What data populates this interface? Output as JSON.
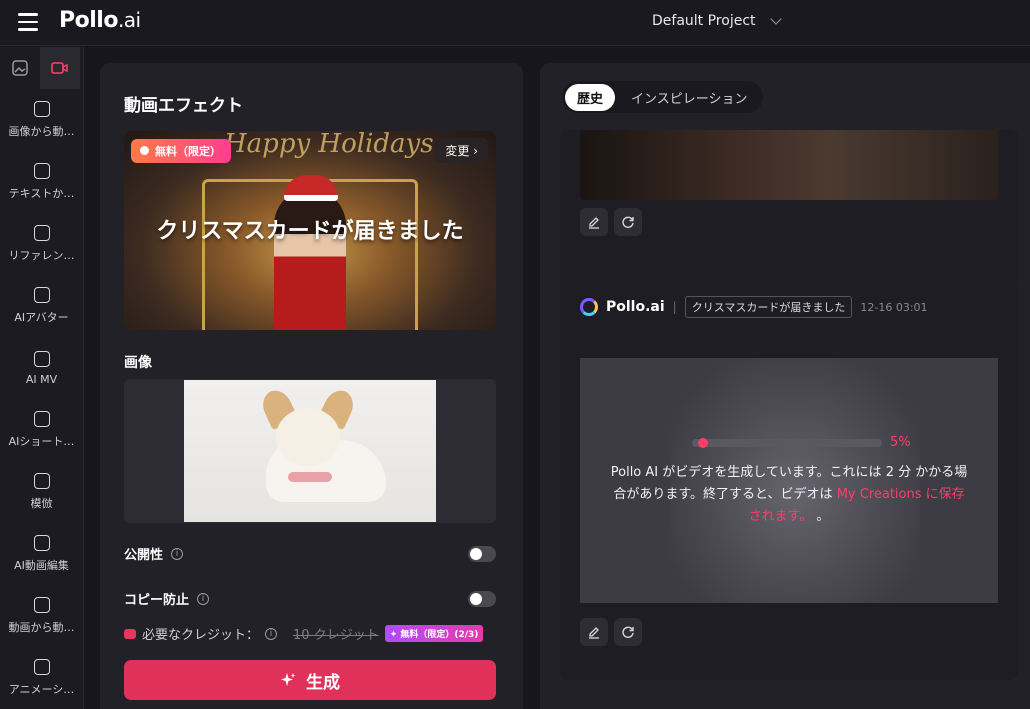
{
  "header": {
    "logo_main": "Pollo",
    "logo_suffix": ".ai",
    "project": "Default Project"
  },
  "sidebar": {
    "items": [
      {
        "label": "画像から動…",
        "icon": "image-to-video-icon"
      },
      {
        "label": "テキストか…",
        "icon": "text-to-video-icon"
      },
      {
        "label": "リファレン…",
        "icon": "reference-icon"
      },
      {
        "label": "AIアバター",
        "icon": "avatar-icon"
      },
      {
        "label": "AI MV",
        "icon": "mv-icon"
      },
      {
        "label": "AIショート…",
        "icon": "short-video-icon"
      },
      {
        "label": "模倣",
        "icon": "imitate-icon"
      },
      {
        "label": "AI動画編集",
        "icon": "video-edit-icon"
      },
      {
        "label": "動画から動…",
        "icon": "video-to-video-icon"
      },
      {
        "label": "アニメーシ…",
        "icon": "animation-icon"
      }
    ]
  },
  "left": {
    "title": "動画エフェクト",
    "banner": {
      "badge": "無料（限定）",
      "change": "変更 ›",
      "text": "クリスマスカードが届きました",
      "script": "Happy Holidays"
    },
    "image_label": "画像",
    "public_label": "公開性",
    "copy_label": "コピー防止",
    "credits_label": "必要なクレジット：",
    "credits_original": "10 クレジット",
    "credits_free": "✦ 無料（限定）(2/3)",
    "generate": "生成"
  },
  "right": {
    "tabs": [
      "歴史",
      "インスピレーション"
    ],
    "card": {
      "brand": "Pollo.ai",
      "separator": "|",
      "effect": "クリスマスカードが届きました",
      "time": "12-16 03:01",
      "progress_fraction": 0.05,
      "progress_text": "5%",
      "message_pre": "Pollo AI がビデオを生成しています。これには 2 分 かかる場合があります。終了すると、ビデオは ",
      "message_link": "My Creations に保存されます。",
      "message_post": " 。"
    }
  },
  "colors": {
    "accent": "#e0315a",
    "progress": "#ff3d6a"
  }
}
